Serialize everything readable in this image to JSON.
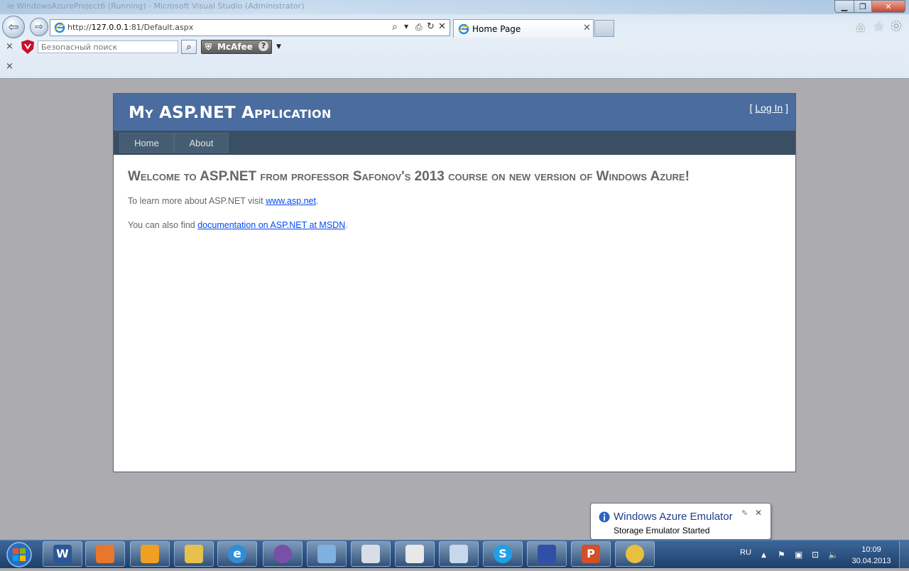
{
  "browser": {
    "window_title_faint": "ie  WindowsAzureProject6 (Running) - Microsoft Visual Studio (Administrator)",
    "address_prefix": "http://",
    "address_host": "127.0.0.1",
    "address_rest": ":81/Default.aspx",
    "tab_title": "Home Page",
    "search_placeholder": "Безопасный поиск",
    "mcafee_label": "McAfee",
    "close_glyph": "×"
  },
  "page": {
    "app_title": "My ASP.NET Application",
    "login_open": "[",
    "login_link": "Log In",
    "login_close": "]",
    "menu": [
      {
        "label": "Home"
      },
      {
        "label": "About"
      }
    ],
    "heading": "Welcome to ASP.NET from professor Safonov's 2013 course on new version of Windows Azure!",
    "para1_prefix": "To learn more about ASP.NET visit ",
    "para1_link": "www.asp.net",
    "para1_suffix": ".",
    "para2_prefix": "You can also find ",
    "para2_link": "documentation on ASP.NET at MSDN",
    "para2_suffix": "."
  },
  "notification": {
    "title": "Windows Azure Emulator",
    "message": "Storage Emulator Started"
  },
  "taskbar": {
    "language": "RU",
    "time": "10:09",
    "date": "30.04.2013",
    "apps": [
      {
        "icon": "word-icon",
        "color": "#2b5797"
      },
      {
        "icon": "media-player-icon",
        "color": "#e8762b"
      },
      {
        "icon": "outlook-icon",
        "color": "#f0a020"
      },
      {
        "icon": "explorer-icon",
        "color": "#e8c050"
      },
      {
        "icon": "internet-explorer-icon",
        "color": "#2e8fd8"
      },
      {
        "icon": "visual-studio-icon",
        "color": "#7a4fa8"
      },
      {
        "icon": "cube-icon",
        "color": "#7fb0e0"
      },
      {
        "icon": "text-editor-icon",
        "color": "#d8dde6"
      },
      {
        "icon": "calculator-grid-icon",
        "color": "#e8e8e8"
      },
      {
        "icon": "calculator-icon",
        "color": "#c8d8ea"
      },
      {
        "icon": "skype-icon",
        "color": "#1fa0e8"
      },
      {
        "icon": "floppy-save-icon",
        "color": "#3050a8"
      },
      {
        "icon": "powerpoint-icon",
        "color": "#d0502a"
      },
      {
        "icon": "paint-icon",
        "color": "#e8c040"
      }
    ]
  }
}
